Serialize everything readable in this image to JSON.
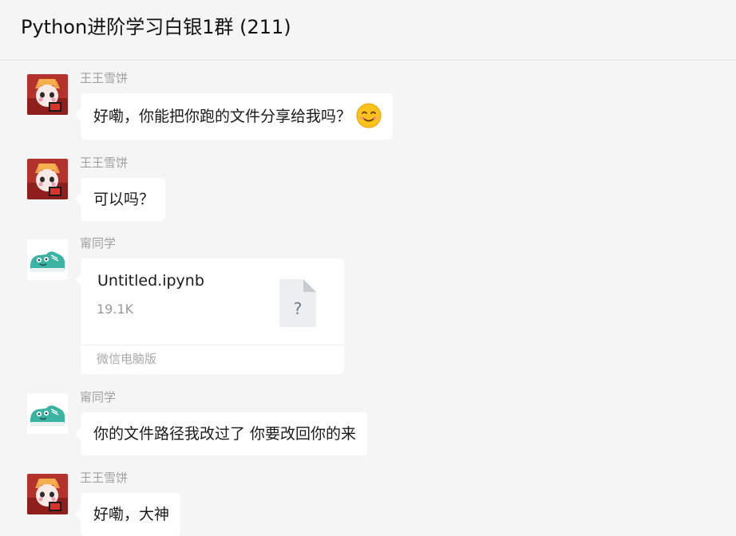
{
  "header": {
    "title": "Python进阶学习白银1群 (211)"
  },
  "messages": [
    {
      "sender": "王王雪饼",
      "text": "好嘞，你能把你跑的文件分享给我吗？",
      "emoji": "smiling-face-emoji"
    },
    {
      "sender": "王王雪饼",
      "text": "可以吗？"
    },
    {
      "sender": "甯同学",
      "file": {
        "name": "Untitled.ipynb",
        "size": "19.1K",
        "icon_glyph": "?",
        "source": "微信电脑版"
      }
    },
    {
      "sender": "甯同学",
      "text": "你的文件路径我改过了 你要改回你的来"
    },
    {
      "sender": "王王雪饼",
      "text": "好嘞，大神"
    }
  ],
  "colors": {
    "background": "#f5f5f5",
    "bubble": "#ffffff",
    "sender": "#a0a0a0",
    "fox_avatar_bg": "#b3322c",
    "shoe_avatar": "#3bb3a3"
  }
}
